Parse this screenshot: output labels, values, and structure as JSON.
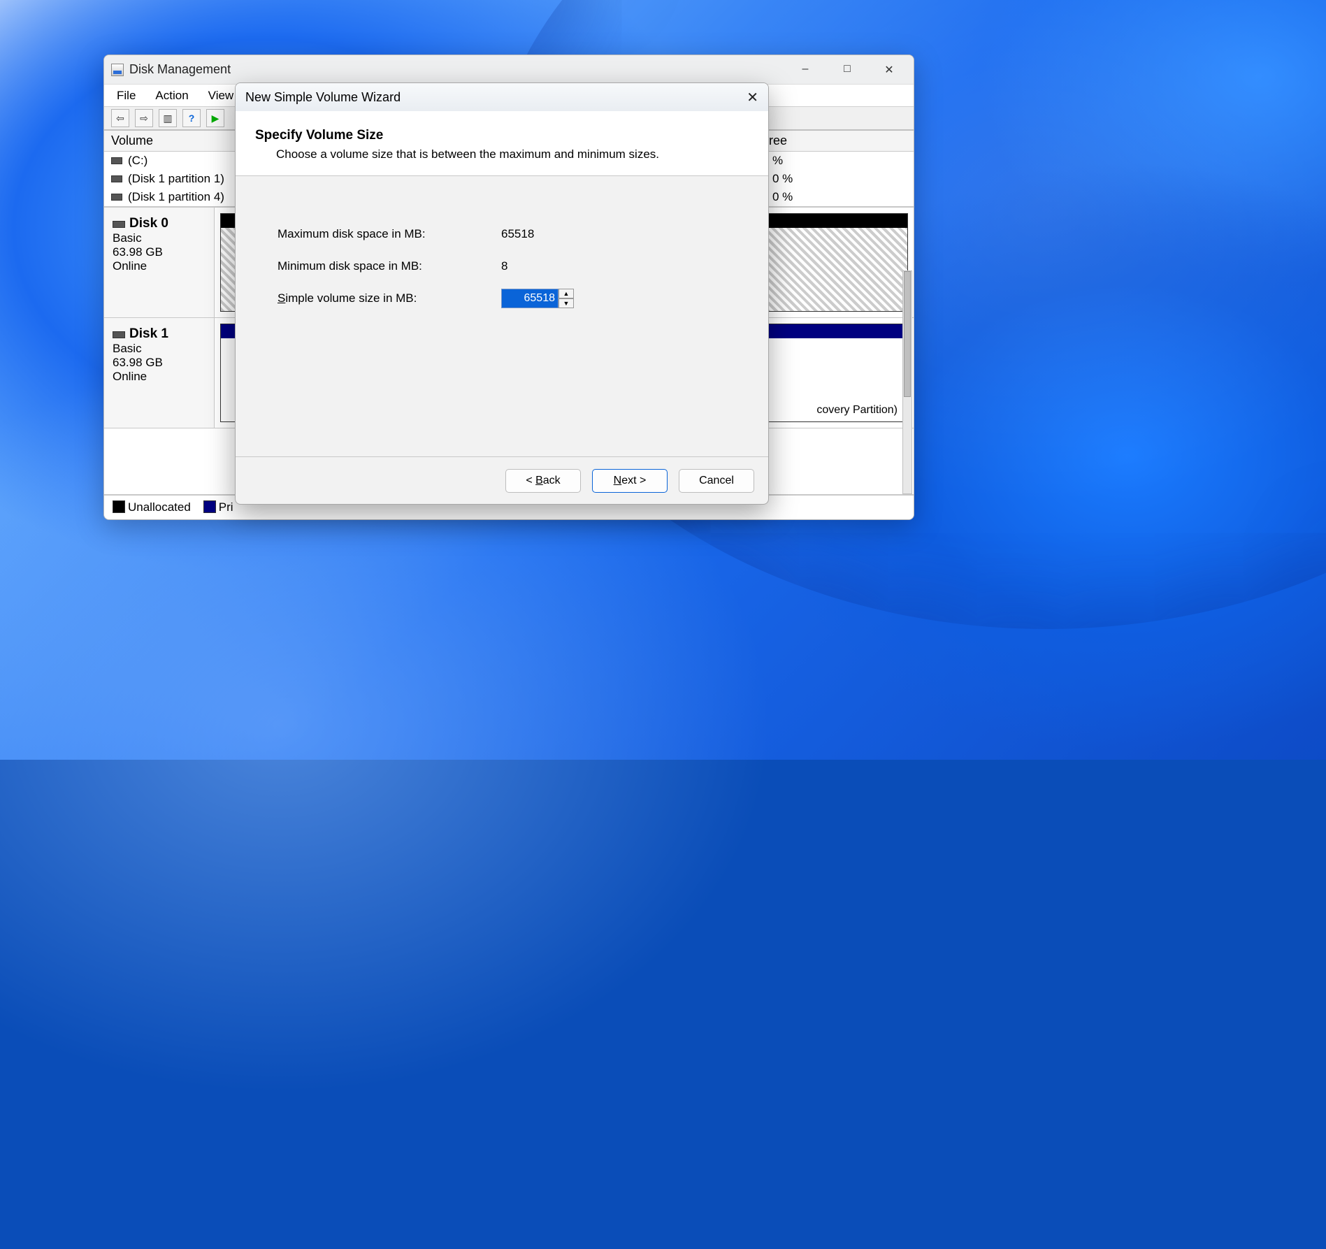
{
  "main_window": {
    "title": "Disk Management",
    "menu": {
      "file": "File",
      "action": "Action",
      "view": "View"
    },
    "columns": {
      "volume": "Volume",
      "free": "Free"
    },
    "volumes": [
      {
        "name": "(C:)",
        "free": "%"
      },
      {
        "name": "(Disk 1 partition 1)",
        "free": "0 %"
      },
      {
        "name": "(Disk 1 partition 4)",
        "free": "0 %"
      }
    ],
    "disks": [
      {
        "name": "Disk 0",
        "type": "Basic",
        "size": "63.98 GB",
        "status": "Online"
      },
      {
        "name": "Disk 1",
        "type": "Basic",
        "size": "63.98 GB",
        "status": "Online",
        "part_label": "covery Partition)"
      }
    ],
    "legend": {
      "unallocated": "Unallocated",
      "primary_prefix": "Pri"
    }
  },
  "wizard": {
    "title": "New Simple Volume Wizard",
    "heading": "Specify Volume Size",
    "subheading": "Choose a volume size that is between the maximum and minimum sizes.",
    "max_label": "Maximum disk space in MB:",
    "max_value": "65518",
    "min_label": "Minimum disk space in MB:",
    "min_value": "8",
    "size_label_pre": "S",
    "size_label_post": "imple volume size in MB:",
    "size_value": "65518",
    "buttons": {
      "back_pre": "< ",
      "back_u": "B",
      "back_post": "ack",
      "next_u": "N",
      "next_post": "ext >",
      "cancel": "Cancel"
    }
  }
}
